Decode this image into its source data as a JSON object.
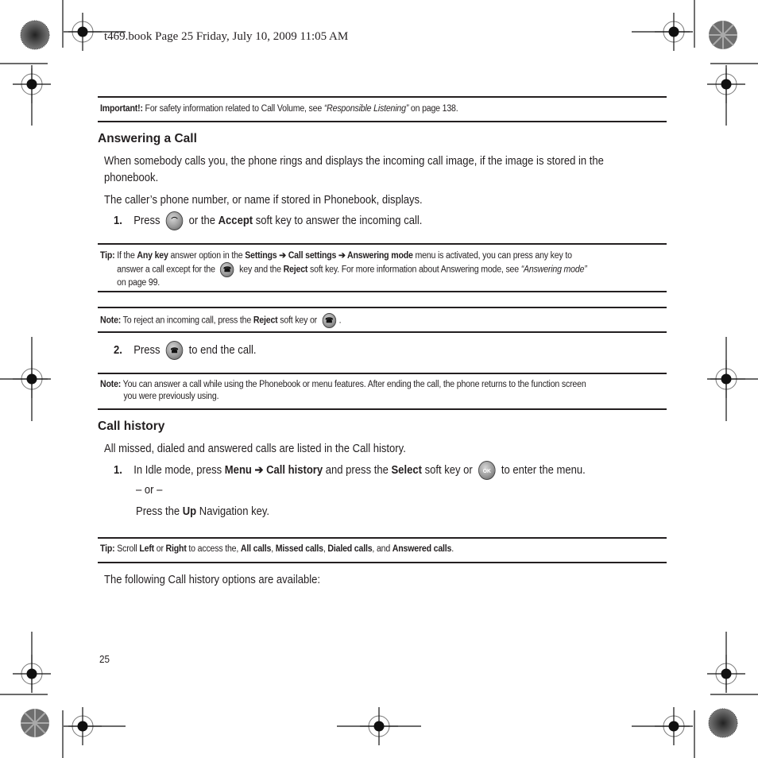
{
  "header": {
    "stamp": "t469.book  Page 25  Friday, July 10, 2009  11:05 AM"
  },
  "important": {
    "label": "Important!:",
    "text_before": " For safety information related to Call Volume, see ",
    "link": "“Responsible Listening”",
    "text_after": " on page 138."
  },
  "section1": {
    "title": "Answering a Call",
    "para1_line1": "When somebody calls you, the phone rings and displays the incoming call image, if the image is stored in the",
    "para1_line2": "phonebook.",
    "para2": "The caller’s phone number, or name if stored in Phonebook, displays.",
    "step1": {
      "num": "1.",
      "pre": "Press",
      "mid": " or the ",
      "bold": "Accept",
      "post": " soft key to answer the incoming call.",
      "icon": "send-key-icon"
    },
    "tip": {
      "label": "Tip:",
      "t1": " If the ",
      "b1": "Any key",
      "t2": " answer option in the ",
      "b2": "Settings",
      "arrow": " ➔ ",
      "b3": "Call settings",
      "b4": "Answering mode",
      "t3": " menu is activated, you can press any key to",
      "l2a": "answer a call except for the ",
      "l2b": " key and the ",
      "l2c": "Reject",
      "l2d": " soft key. For more information about Answering mode, see ",
      "l2e": "“Answering mode”",
      "l3": "on page 99."
    },
    "note1": {
      "label": "Note:",
      "t1": " To reject an incoming call, press the ",
      "b1": "Reject",
      "t2": " soft key or ",
      "t3": "."
    },
    "step2": {
      "num": "2.",
      "pre": "Press",
      "post": " to end the call.",
      "icon": "end-key-icon"
    },
    "note2": {
      "label": "Note:",
      "l1": " You can answer a call while using the Phonebook or menu features. After ending the call, the phone returns to the function screen",
      "l2": "you were previously using."
    }
  },
  "section2": {
    "title": "Call history",
    "para1": "All missed, dialed and answered calls are listed in the Call history.",
    "step1": {
      "num": "1.",
      "t1": "In Idle mode, press ",
      "b1": "Menu",
      "arrow": " ➔ ",
      "b2": "Call history",
      "t2": " and press the ",
      "b3": "Select",
      "t3": " soft key or ",
      "t4": " to enter the menu.",
      "ok_label": "OK"
    },
    "or": "– or –",
    "alt": {
      "t1": "Press the ",
      "b1": "Up",
      "t2": " Navigation key."
    },
    "tip": {
      "label": "Tip:",
      "t1": " Scroll ",
      "b1": "Left",
      "t2": " or ",
      "b2": "Right",
      "t3": " to access the, ",
      "b3": "All calls",
      "c1": ", ",
      "b4": "Missed calls",
      "c2": ", ",
      "b5": "Dialed calls",
      "t4": ", and ",
      "b6": "Answered calls",
      "t5": "."
    },
    "para2": "The following Call history options are available:"
  },
  "footer": {
    "page_number": "25"
  }
}
